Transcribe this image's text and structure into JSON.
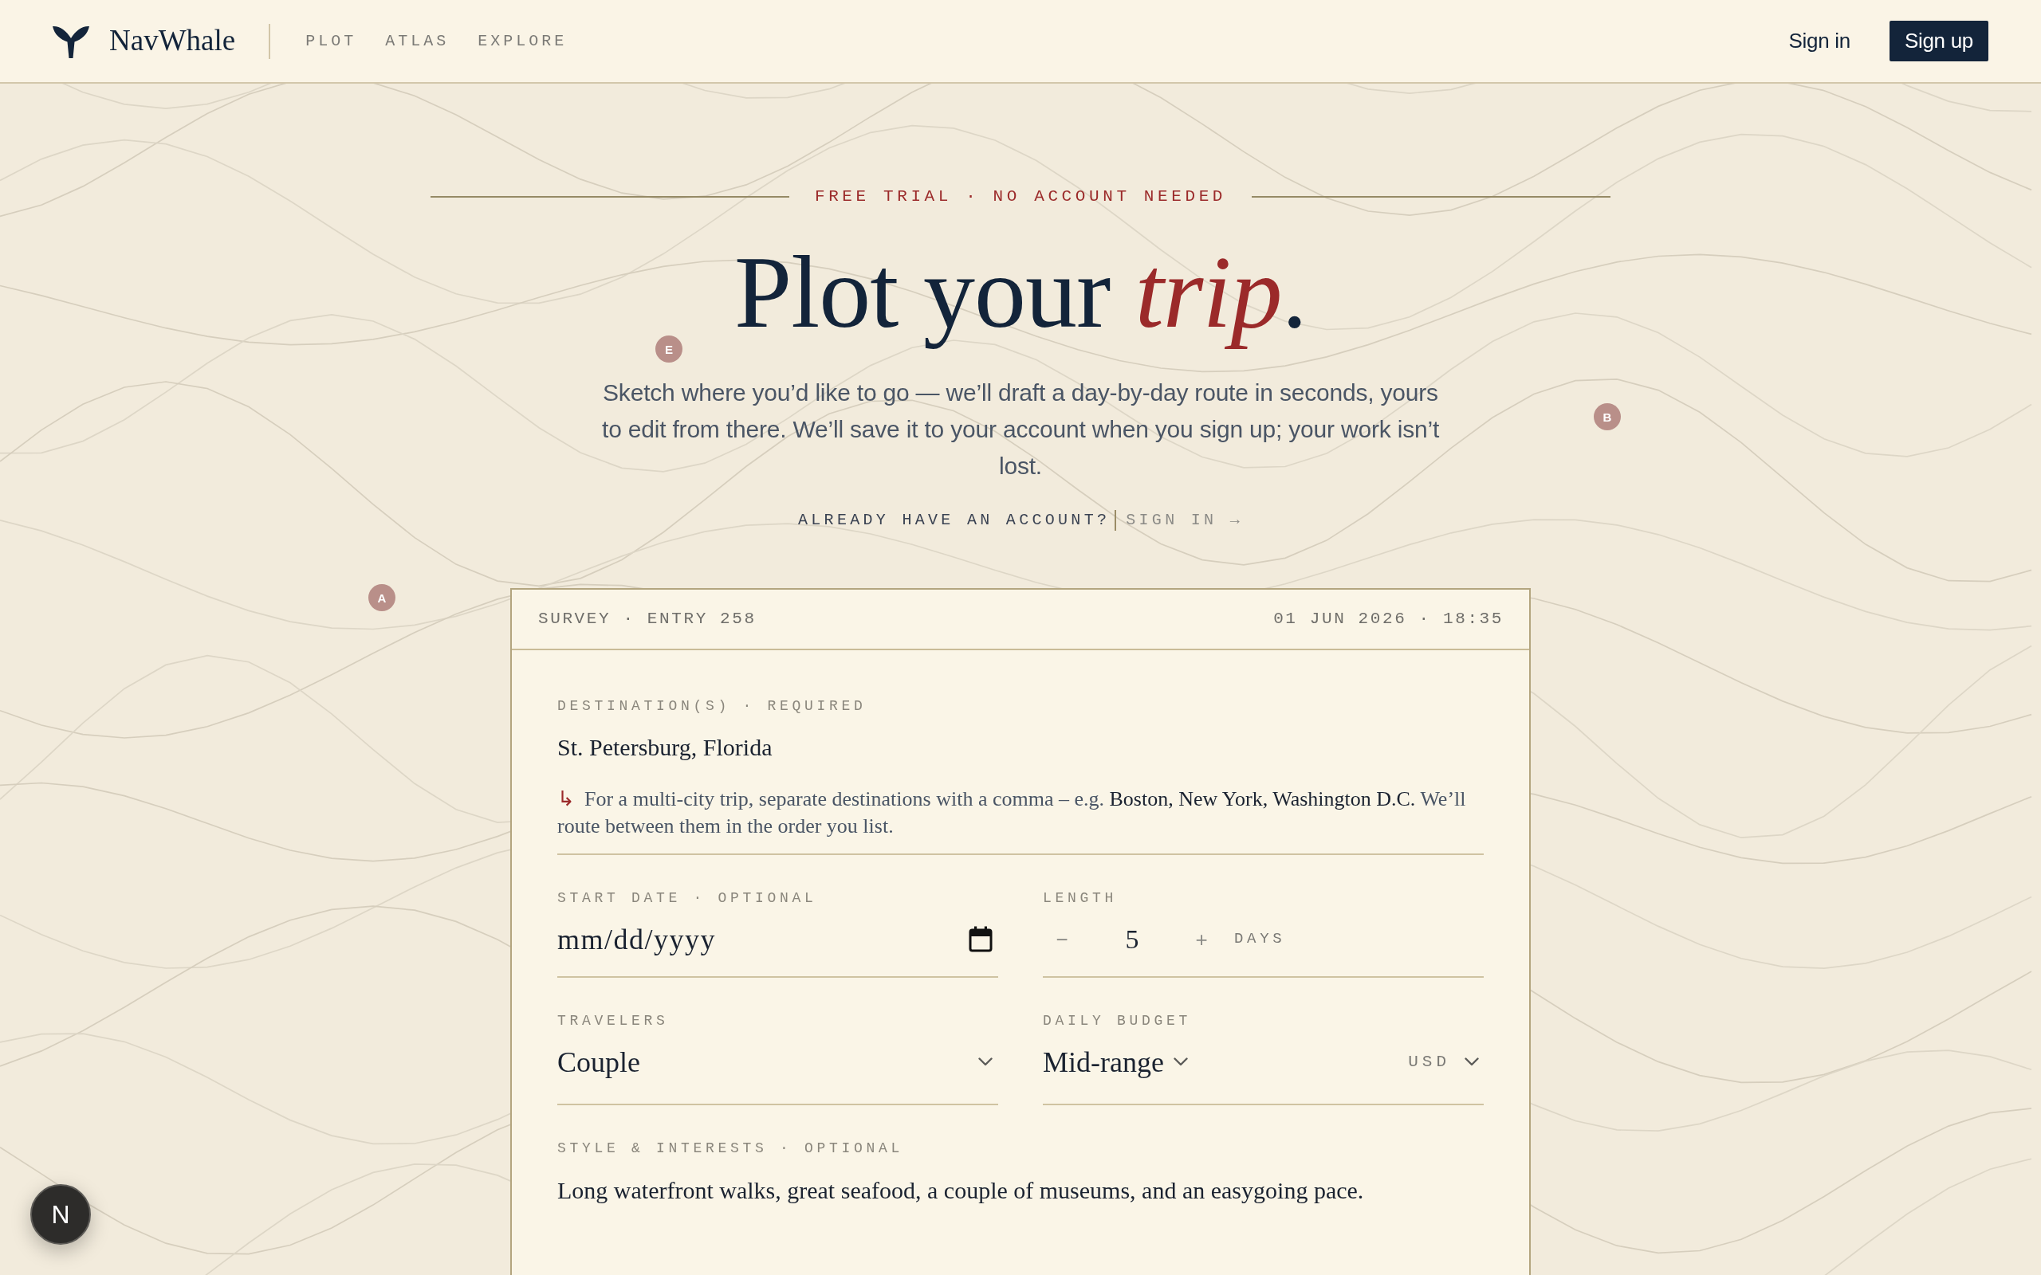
{
  "header": {
    "brand": "NavWhale",
    "nav": [
      {
        "label": "PLOT"
      },
      {
        "label": "ATLAS"
      },
      {
        "label": "EXPLORE"
      }
    ],
    "sign_in": "Sign in",
    "sign_up": "Sign up"
  },
  "hero": {
    "eyebrow": "FREE TRIAL · NO ACCOUNT NEEDED",
    "title": "Plot your *trip*.",
    "subtitle": "Sketch where you’d like to go — we’ll draft a day-by-day route in seconds, yours to edit from there. We’ll save it to your account when you sign up; your work isn’t lost.",
    "account_prompt": "ALREADY HAVE AN ACCOUNT?",
    "account_link": "SIGN IN →"
  },
  "map_markers": [
    {
      "label": "E"
    },
    {
      "label": "B"
    },
    {
      "label": "A"
    }
  ],
  "survey": {
    "entry": "SURVEY · ENTRY 258",
    "timestamp": "01 JUN 2026 · 18:35",
    "destination": {
      "label": "DESTINATION(S) · REQUIRED",
      "value": "St. Petersburg, Florida",
      "hint_marker": "↳",
      "hint": "For a multi-city trip, separate destinations with a comma – e.g. **Boston, New York, Washington D.C.** We’ll route between them in the order you list."
    },
    "start_date": {
      "label": "START DATE · OPTIONAL",
      "placeholder": "mm/dd/yyyy"
    },
    "length": {
      "label": "LENGTH",
      "decrement": "−",
      "value": "5",
      "increment": "+",
      "unit": "DAYS"
    },
    "travelers": {
      "label": "TRAVELERS",
      "value": "Couple"
    },
    "daily_budget": {
      "label": "DAILY BUDGET",
      "value": "Mid-range",
      "currency": "USD"
    },
    "style_interests": {
      "label": "STYLE & INTERESTS · OPTIONAL",
      "value": "Long waterfront walks, great seafood, a couple of museums, and an easygoing pace."
    }
  },
  "dev_badge": {
    "label": "N"
  }
}
